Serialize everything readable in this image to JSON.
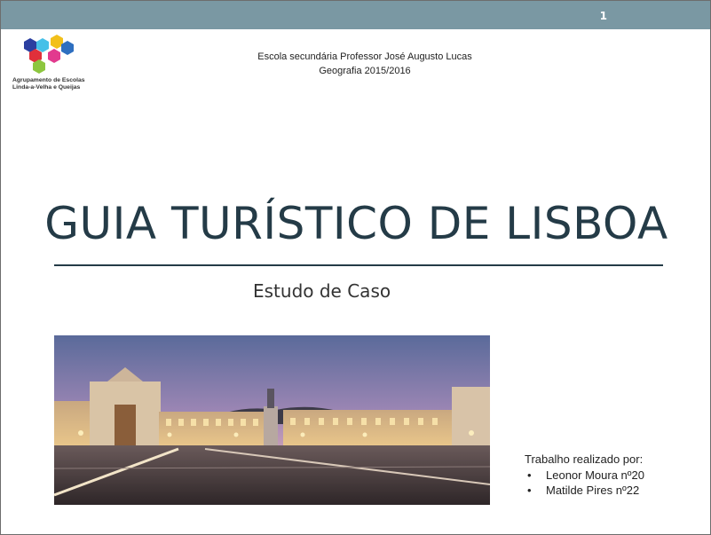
{
  "slide": {
    "page_number": "1",
    "logo": {
      "line1": "Agrupamento de Escolas",
      "line2": "Linda-a-Velha  e  Queijas",
      "colors": [
        "#2b3fa0",
        "#46c0e8",
        "#f2c01a",
        "#2e6fc0",
        "#e0303a",
        "#e23a8e",
        "#8dc63f"
      ]
    },
    "school": "Escola secundária Professor José Augusto Lucas",
    "year": "Geografia 2015/2016",
    "title": "GUIA TURÍSTICO DE LISBOA",
    "subtitle": "Estudo de Caso",
    "photo_alt": "Praça do Comércio",
    "authors": {
      "heading": "Trabalho realizado por:",
      "names": [
        "Leonor Moura nº20",
        "Matilde Pires nº22"
      ]
    },
    "colors": {
      "header_bar": "#7a98a3",
      "title": "#243b47"
    }
  }
}
